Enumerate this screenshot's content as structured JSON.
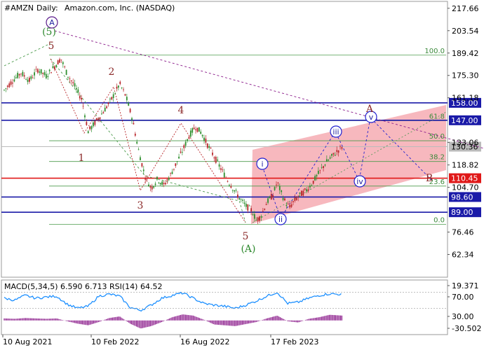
{
  "header": {
    "symbol": "#AMZN",
    "timeframe": "Daily:",
    "company": "Amazon.com, Inc. (NASDAQ)"
  },
  "indicator_label": "MACD(5,34,5) 6.590 6.713 RSI(14) 64.52",
  "chart_data": {
    "type": "line",
    "title": "#AMZN, Daily:  Amazon.com, Inc. (NASDAQ)",
    "price_ticks": [
      "217.66",
      "203.54",
      "189.42",
      "175.30",
      "161.18",
      "133.06",
      "118.82",
      "104.70",
      "76.46",
      "62.34"
    ],
    "indicator_ticks": [
      "19.371",
      "70.00",
      "30.00",
      "-30.502"
    ],
    "x_ticks": [
      "10 Aug 2021",
      "10 Feb 2022",
      "16 Aug 2022",
      "17 Feb 2023"
    ],
    "levels": [
      {
        "value": 158.0,
        "label": "158.00",
        "color": "#1a1aa8"
      },
      {
        "value": 147.0,
        "label": "147.00",
        "color": "#1a1aa8"
      },
      {
        "value": 130.36,
        "label": "130.36",
        "color": "#bbbbbb"
      },
      {
        "value": 110.45,
        "label": "110.45",
        "color": "#e01818"
      },
      {
        "value": 98.6,
        "label": "98.60",
        "color": "#1a1aa8"
      },
      {
        "value": 89.0,
        "label": "89.00",
        "color": "#1a1aa8"
      }
    ],
    "fibonacci": [
      {
        "label": "100.0",
        "value": 188.1
      },
      {
        "label": "61.8",
        "value": 146.8
      },
      {
        "label": "50.0",
        "value": 134.1
      },
      {
        "label": "38.2",
        "value": 121.0
      },
      {
        "label": "23.6",
        "value": 105.5
      },
      {
        "label": "0.0",
        "value": 81.4
      }
    ],
    "waves": [
      {
        "label": "(5)",
        "style": "green"
      },
      {
        "label": "5",
        "style": "red"
      },
      {
        "label": "1",
        "style": "red"
      },
      {
        "label": "2",
        "style": "red"
      },
      {
        "label": "3",
        "style": "red"
      },
      {
        "label": "4",
        "style": "red"
      },
      {
        "label": "5",
        "style": "red"
      },
      {
        "label": "(A)",
        "style": "green"
      },
      {
        "label": "i",
        "style": "blue"
      },
      {
        "label": "ii",
        "style": "blue"
      },
      {
        "label": "iii",
        "style": "blue"
      },
      {
        "label": "iv",
        "style": "blue"
      },
      {
        "label": "v",
        "style": "blue"
      },
      {
        "label": "A",
        "style": "circle"
      },
      {
        "label": "A",
        "style": "red"
      },
      {
        "label": "B",
        "style": "red"
      }
    ],
    "price_series": [
      {
        "t": 0,
        "v": 166
      },
      {
        "t": 8,
        "v": 172
      },
      {
        "t": 16,
        "v": 177
      },
      {
        "t": 24,
        "v": 172
      },
      {
        "t": 32,
        "v": 179
      },
      {
        "t": 40,
        "v": 175
      },
      {
        "t": 48,
        "v": 181
      },
      {
        "t": 54,
        "v": 186
      },
      {
        "t": 60,
        "v": 176
      },
      {
        "t": 66,
        "v": 170
      },
      {
        "t": 74,
        "v": 160
      },
      {
        "t": 80,
        "v": 140
      },
      {
        "t": 86,
        "v": 145
      },
      {
        "t": 94,
        "v": 152
      },
      {
        "t": 102,
        "v": 160
      },
      {
        "t": 110,
        "v": 170
      },
      {
        "t": 116,
        "v": 162
      },
      {
        "t": 122,
        "v": 148
      },
      {
        "t": 128,
        "v": 128
      },
      {
        "t": 134,
        "v": 112
      },
      {
        "t": 140,
        "v": 104
      },
      {
        "t": 146,
        "v": 110
      },
      {
        "t": 152,
        "v": 106
      },
      {
        "t": 158,
        "v": 112
      },
      {
        "t": 164,
        "v": 120
      },
      {
        "t": 170,
        "v": 128
      },
      {
        "t": 176,
        "v": 137
      },
      {
        "t": 182,
        "v": 143
      },
      {
        "t": 188,
        "v": 139
      },
      {
        "t": 194,
        "v": 131
      },
      {
        "t": 200,
        "v": 124
      },
      {
        "t": 206,
        "v": 117
      },
      {
        "t": 212,
        "v": 110
      },
      {
        "t": 218,
        "v": 104
      },
      {
        "t": 224,
        "v": 98
      },
      {
        "t": 230,
        "v": 93
      },
      {
        "t": 236,
        "v": 90
      },
      {
        "t": 240,
        "v": 84
      },
      {
        "t": 244,
        "v": 86
      },
      {
        "t": 250,
        "v": 95
      },
      {
        "t": 256,
        "v": 100
      },
      {
        "t": 260,
        "v": 108
      },
      {
        "t": 264,
        "v": 101
      },
      {
        "t": 268,
        "v": 95
      },
      {
        "t": 272,
        "v": 92
      },
      {
        "t": 276,
        "v": 96
      },
      {
        "t": 282,
        "v": 100
      },
      {
        "t": 288,
        "v": 103
      },
      {
        "t": 294,
        "v": 108
      },
      {
        "t": 300,
        "v": 114
      },
      {
        "t": 306,
        "v": 120
      },
      {
        "t": 312,
        "v": 124
      },
      {
        "t": 318,
        "v": 128
      },
      {
        "t": 322,
        "v": 130.4
      }
    ],
    "macd_series": [
      {
        "t": 0,
        "v": 5
      },
      {
        "t": 10,
        "v": 4
      },
      {
        "t": 20,
        "v": 6
      },
      {
        "t": 30,
        "v": 5
      },
      {
        "t": 40,
        "v": 4
      },
      {
        "t": 50,
        "v": 5
      },
      {
        "t": 60,
        "v": -2
      },
      {
        "t": 70,
        "v": -8
      },
      {
        "t": 80,
        "v": -12
      },
      {
        "t": 90,
        "v": -4
      },
      {
        "t": 100,
        "v": 6
      },
      {
        "t": 110,
        "v": 10
      },
      {
        "t": 120,
        "v": -8
      },
      {
        "t": 130,
        "v": -20
      },
      {
        "t": 140,
        "v": -14
      },
      {
        "t": 150,
        "v": -4
      },
      {
        "t": 160,
        "v": 8
      },
      {
        "t": 170,
        "v": 15
      },
      {
        "t": 180,
        "v": 12
      },
      {
        "t": 190,
        "v": 2
      },
      {
        "t": 200,
        "v": -10
      },
      {
        "t": 210,
        "v": -12
      },
      {
        "t": 220,
        "v": -14
      },
      {
        "t": 230,
        "v": -9
      },
      {
        "t": 240,
        "v": -4
      },
      {
        "t": 250,
        "v": 5
      },
      {
        "t": 260,
        "v": 12
      },
      {
        "t": 270,
        "v": -2
      },
      {
        "t": 280,
        "v": -5
      },
      {
        "t": 290,
        "v": 4
      },
      {
        "t": 300,
        "v": 8
      },
      {
        "t": 310,
        "v": 14
      },
      {
        "t": 322,
        "v": 12
      }
    ],
    "rsi_series": [
      {
        "t": 0,
        "v": 55
      },
      {
        "t": 10,
        "v": 50
      },
      {
        "t": 20,
        "v": 62
      },
      {
        "t": 30,
        "v": 55
      },
      {
        "t": 40,
        "v": 58
      },
      {
        "t": 50,
        "v": 60
      },
      {
        "t": 60,
        "v": 40
      },
      {
        "t": 70,
        "v": 30
      },
      {
        "t": 80,
        "v": 35
      },
      {
        "t": 90,
        "v": 60
      },
      {
        "t": 100,
        "v": 65
      },
      {
        "t": 110,
        "v": 60
      },
      {
        "t": 120,
        "v": 32
      },
      {
        "t": 130,
        "v": 25
      },
      {
        "t": 140,
        "v": 38
      },
      {
        "t": 150,
        "v": 55
      },
      {
        "t": 160,
        "v": 62
      },
      {
        "t": 170,
        "v": 68
      },
      {
        "t": 180,
        "v": 55
      },
      {
        "t": 190,
        "v": 42
      },
      {
        "t": 200,
        "v": 38
      },
      {
        "t": 210,
        "v": 35
      },
      {
        "t": 220,
        "v": 30
      },
      {
        "t": 230,
        "v": 38
      },
      {
        "t": 240,
        "v": 48
      },
      {
        "t": 250,
        "v": 60
      },
      {
        "t": 260,
        "v": 70
      },
      {
        "t": 270,
        "v": 42
      },
      {
        "t": 280,
        "v": 45
      },
      {
        "t": 290,
        "v": 55
      },
      {
        "t": 300,
        "v": 62
      },
      {
        "t": 310,
        "v": 66
      },
      {
        "t": 322,
        "v": 64.5
      }
    ],
    "colors": {
      "candle_up": "#2f8f2f",
      "candle_down": "#b8262a",
      "channel": "#f4a0a8",
      "macd_hist": "#8a1a8a",
      "rsi": "#1e90ff"
    },
    "ylim": [
      48,
      222
    ],
    "indicator_ylim": [
      -35,
      100
    ]
  }
}
